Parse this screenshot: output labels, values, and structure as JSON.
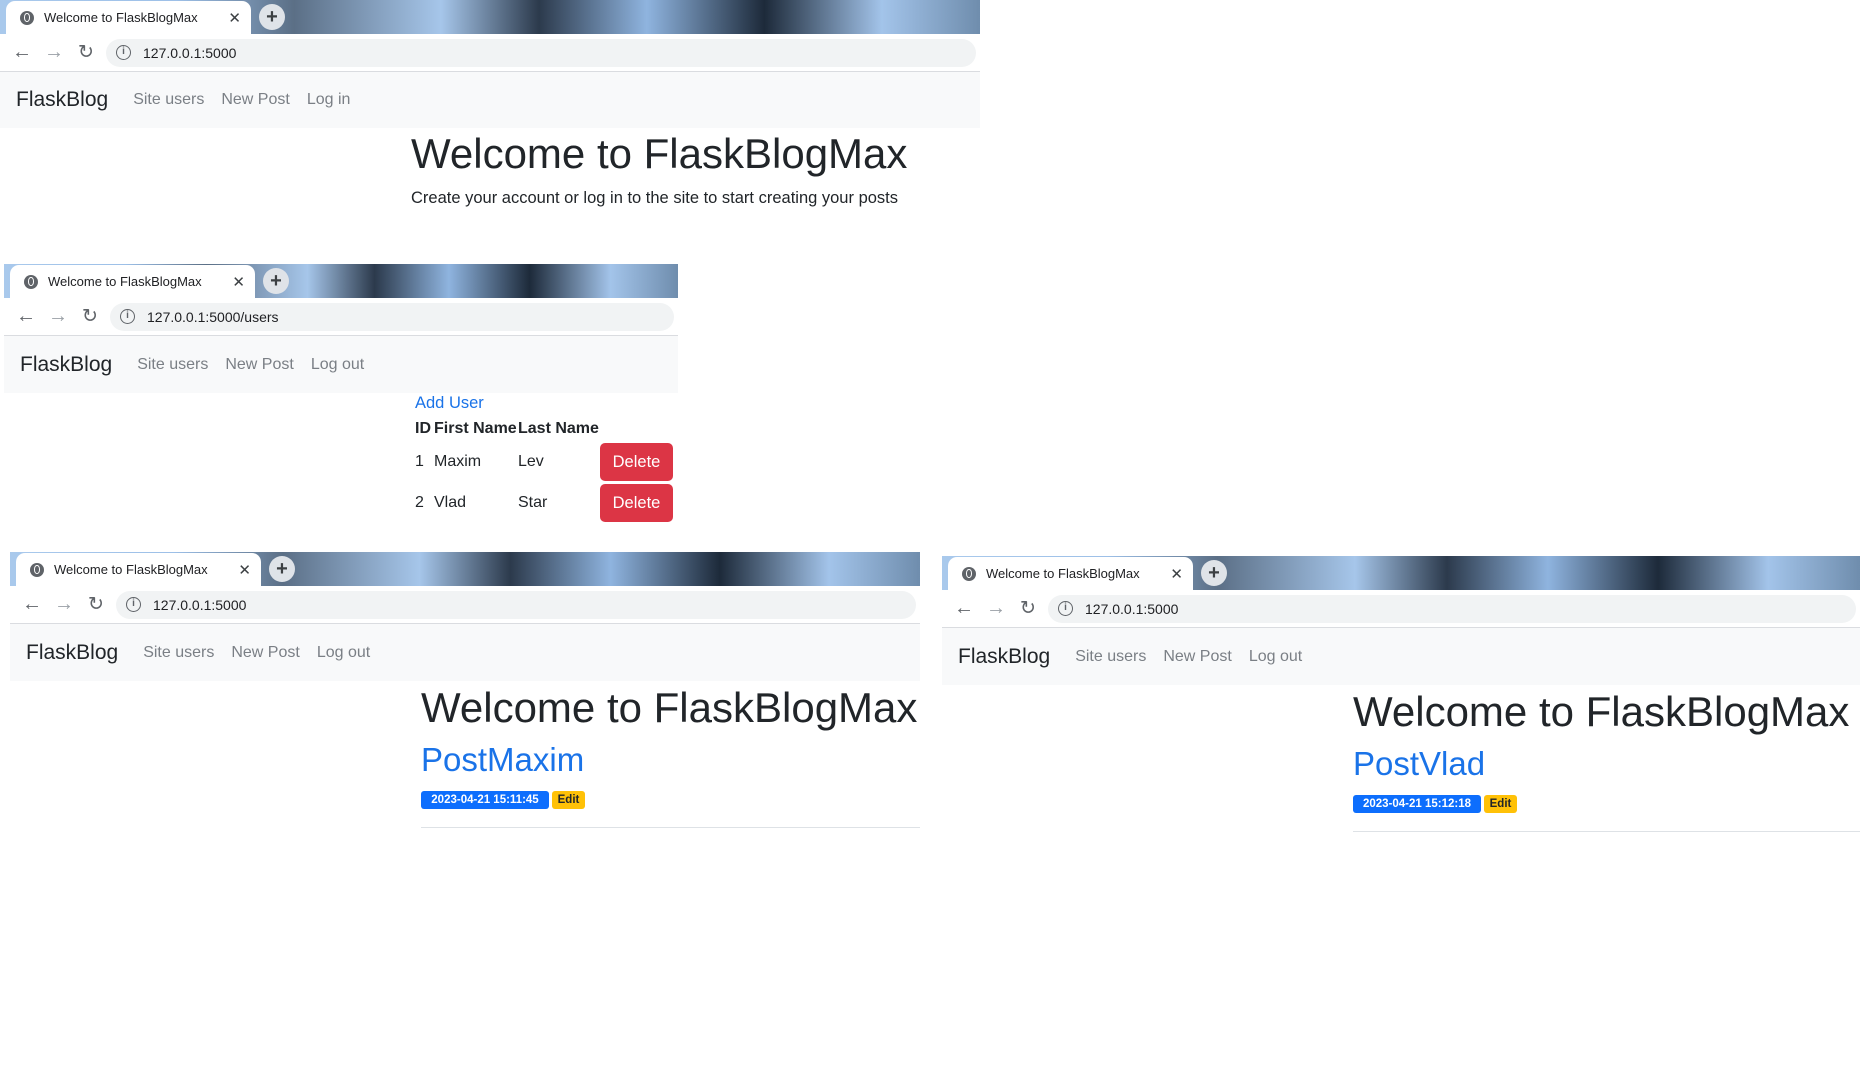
{
  "colors": {
    "link_blue": "#1a73e8",
    "badge_date": "#0d6efd",
    "badge_edit": "#ffc107",
    "delete_red": "#dc3545",
    "navbar_bg": "#f8f9fa"
  },
  "shot1": {
    "tab_title": "Welcome to FlaskBlogMax",
    "url": "127.0.0.1:5000",
    "brand": "FlaskBlog",
    "nav": [
      "Site users",
      "New Post",
      "Log in"
    ],
    "heading": "Welcome to FlaskBlogMax",
    "lead": "Create your account or log in to the site to start creating your posts"
  },
  "shot2": {
    "tab_title": "Welcome to FlaskBlogMax",
    "url": "127.0.0.1:5000/users",
    "brand": "FlaskBlog",
    "nav": [
      "Site users",
      "New Post",
      "Log out"
    ],
    "add_user": "Add User",
    "columns": [
      "ID",
      "First Name",
      "Last Name"
    ],
    "rows": [
      {
        "id": "1",
        "first": "Maxim",
        "last": "Lev",
        "action": "Delete"
      },
      {
        "id": "2",
        "first": "Vlad",
        "last": "Star",
        "action": "Delete"
      }
    ]
  },
  "shot3": {
    "tab_title": "Welcome to FlaskBlogMax",
    "url": "127.0.0.1:5000",
    "brand": "FlaskBlog",
    "nav": [
      "Site users",
      "New Post",
      "Log out"
    ],
    "heading": "Welcome to FlaskBlogMax",
    "post_title": "PostMaxim",
    "date": "2023-04-21 15:11:45",
    "edit": "Edit"
  },
  "shot4": {
    "tab_title": "Welcome to FlaskBlogMax",
    "url": "127.0.0.1:5000",
    "brand": "FlaskBlog",
    "nav": [
      "Site users",
      "New Post",
      "Log out"
    ],
    "heading": "Welcome to FlaskBlogMax",
    "post_title": "PostVlad",
    "date": "2023-04-21 15:12:18",
    "edit": "Edit"
  }
}
